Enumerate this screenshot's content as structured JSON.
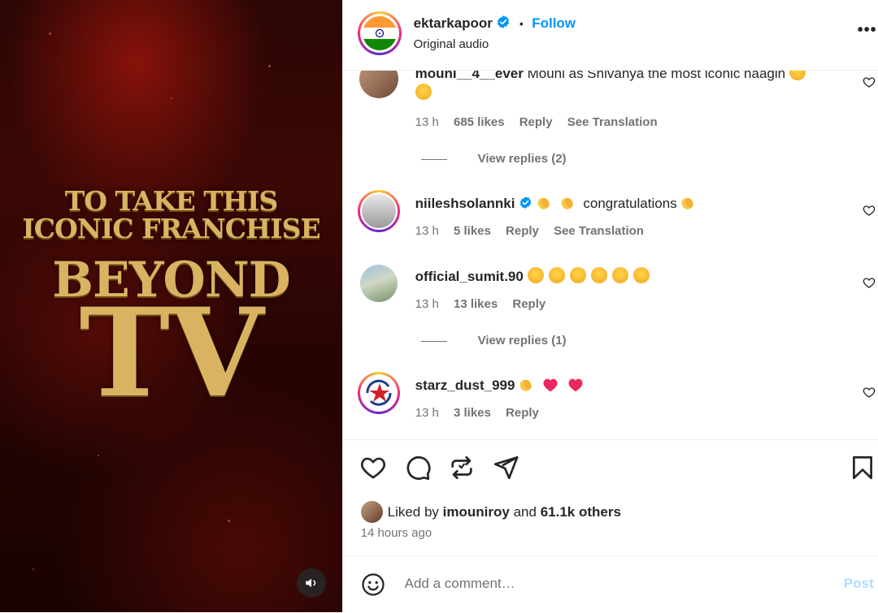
{
  "media": {
    "overlay_line1": "TO TAKE THIS",
    "overlay_line2": "ICONIC FRANCHISE",
    "overlay_line3": "BEYOND",
    "overlay_line4": "TV",
    "audio_icon": "speaker-icon"
  },
  "header": {
    "username": "ektarkapoor",
    "separator": "•",
    "follow_label": "Follow",
    "subtitle": "Original audio",
    "more_label": "•••"
  },
  "comments": [
    {
      "username": "mouni__4__ever",
      "text": "Mouni as Shivanya the most iconic naagin",
      "time": "13 h",
      "likes": "685 likes",
      "reply": "Reply",
      "translate": "See Translation",
      "view_replies": "View replies (2)"
    },
    {
      "username": "niileshsolannki",
      "text": "congratulations",
      "time": "13 h",
      "likes": "5 likes",
      "reply": "Reply",
      "translate": "See Translation"
    },
    {
      "username": "official_sumit.90",
      "text": "",
      "time": "13 h",
      "likes": "13 likes",
      "reply": "Reply",
      "view_replies": "View replies (1)"
    },
    {
      "username": "starz_dust_999",
      "text": "",
      "time": "13 h",
      "likes": "3 likes",
      "reply": "Reply"
    }
  ],
  "actions": {
    "liked_by_prefix": "Liked by",
    "liked_by_user": "imouniroy",
    "liked_by_and": "and",
    "liked_by_others": "61.1k others",
    "time_ago": "14 hours ago"
  },
  "composer": {
    "placeholder": "Add a comment…",
    "post_label": "Post"
  },
  "colors": {
    "accent": "#0095f6",
    "post_disabled": "#b3dbff",
    "gold_text": "#d9b361"
  }
}
